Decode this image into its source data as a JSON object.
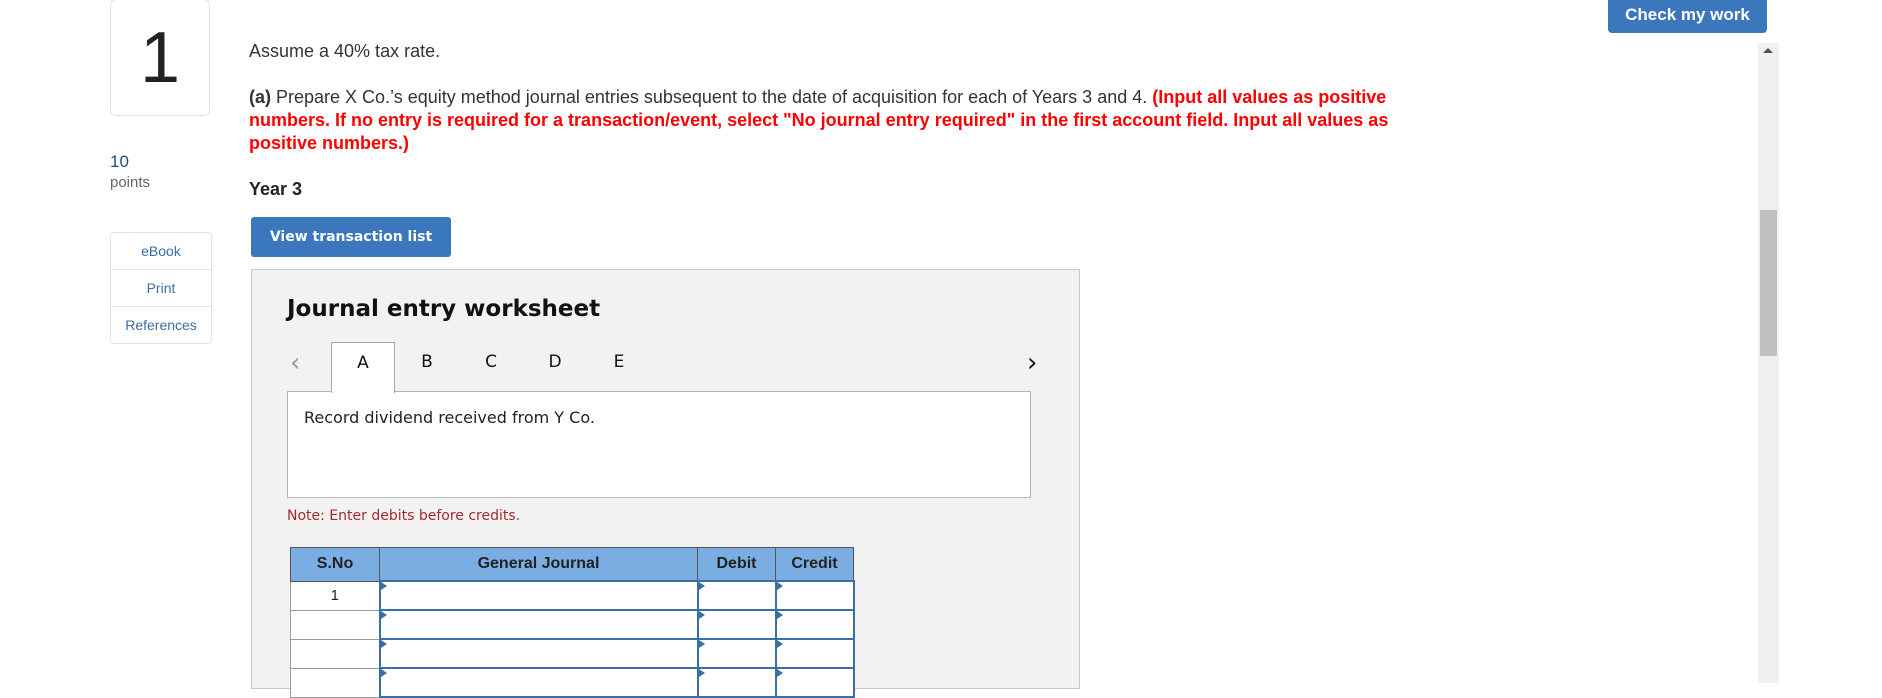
{
  "question": {
    "number": "1",
    "points_value": "10",
    "points_label": "points",
    "intro": "Assume a 40% tax rate.",
    "part_label": "(a)",
    "part_text": " Prepare X Co.’s equity method journal entries subsequent to the date of acquisition for each of Years 3 and 4. ",
    "part_warning": "(Input all values as positive numbers. If no entry is required for a transaction/event, select \"No journal entry required\" in the first account field. Input all values as positive numbers.)",
    "year_label": "Year 3"
  },
  "side_links": [
    {
      "label": "eBook"
    },
    {
      "label": "Print"
    },
    {
      "label": "References"
    }
  ],
  "buttons": {
    "check_my_work": "Check my work",
    "view_transaction_list": "View transaction list"
  },
  "worksheet": {
    "title": "Journal entry worksheet",
    "prev_icon": "‹",
    "next_icon": "›",
    "tabs": [
      {
        "label": "A",
        "active": true
      },
      {
        "label": "B",
        "active": false
      },
      {
        "label": "C",
        "active": false
      },
      {
        "label": "D",
        "active": false
      },
      {
        "label": "E",
        "active": false
      }
    ],
    "description": "Record dividend received from Y Co.",
    "note": "Note: Enter debits before credits.",
    "table": {
      "headers": [
        "S.No",
        "General Journal",
        "Debit",
        "Credit"
      ],
      "rows": [
        {
          "sno": "1",
          "account": "",
          "debit": "",
          "credit": ""
        },
        {
          "sno": "",
          "account": "",
          "debit": "",
          "credit": ""
        },
        {
          "sno": "",
          "account": "",
          "debit": "",
          "credit": ""
        },
        {
          "sno": "",
          "account": "",
          "debit": "",
          "credit": ""
        }
      ]
    }
  },
  "colors": {
    "primary_button": "#3b77bc",
    "warning_text": "#ff0000",
    "note_text": "#a52a2a",
    "table_header": "#7aaee3",
    "worksheet_bg": "#f2f2f2"
  }
}
